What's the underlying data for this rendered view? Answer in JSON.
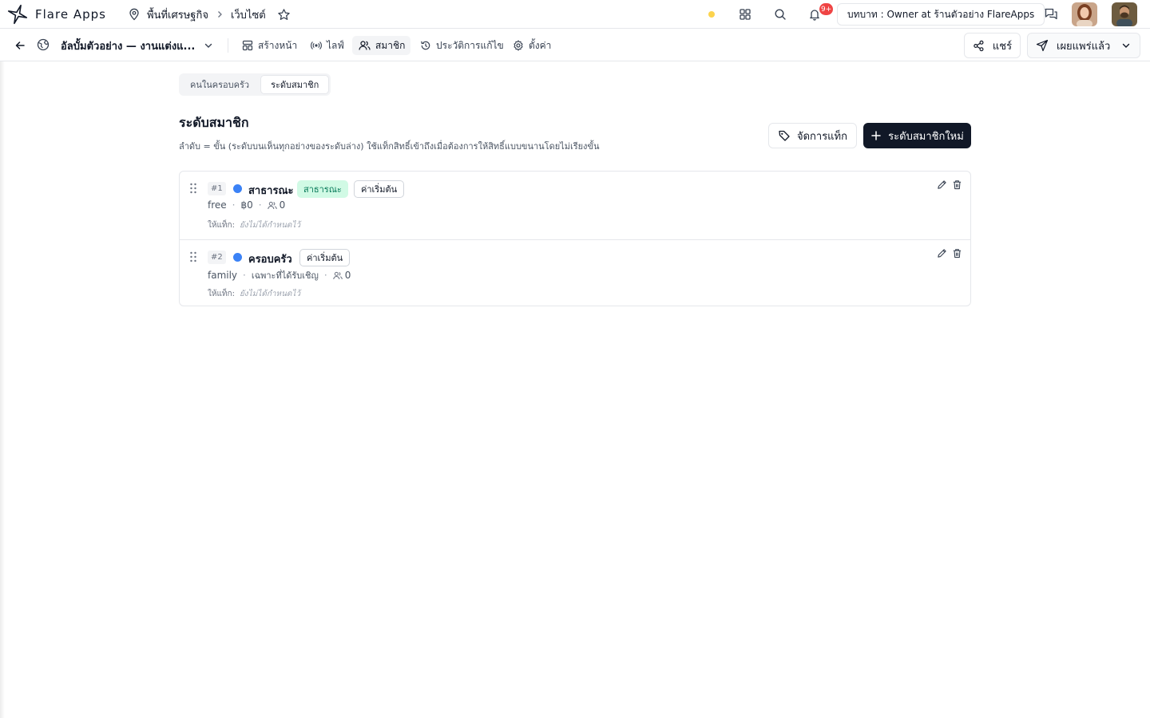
{
  "app": {
    "name": "Flare Apps"
  },
  "breadcrumb": {
    "workspace": "พื้นที่เศรษฐกิจ",
    "section": "เว็บไซต์"
  },
  "header": {
    "notification_count": "9+",
    "role": "บทบาท : Owner at ร้านตัวอย่าง FlareApps"
  },
  "project": {
    "title": "อัลบั้มตัวอย่าง — งานแต่งแ...",
    "tabs": [
      {
        "label": "สร้างหน้า",
        "icon": "layout-icon"
      },
      {
        "label": "ไลฟ์",
        "icon": "live-icon"
      },
      {
        "label": "สมาชิก",
        "icon": "users-icon",
        "active": true
      },
      {
        "label": "ประวัติการแก้ไข",
        "icon": "history-icon"
      },
      {
        "label": "ตั้งค่า",
        "icon": "gear-icon"
      }
    ],
    "share_label": "แชร์",
    "publish_label": "เผยแพร่แล้ว"
  },
  "segments": [
    {
      "label": "คนในครอบครัว",
      "active": false
    },
    {
      "label": "ระดับสมาชิก",
      "active": true
    }
  ],
  "page": {
    "title": "ระดับสมาชิก",
    "description": "ลำดับ = ขั้น (ระดับบนเห็นทุกอย่างของระดับล่าง) ใช้แท็กสิทธิ์เข้าถึงเมื่อต้องการให้สิทธิ์แบบขนานโดยไม่เรียงขั้น",
    "manage_tags_label": "จัดการแท็ก",
    "new_tier_label": "ระดับสมาชิกใหม่"
  },
  "tiers": [
    {
      "rank": "#1",
      "name": "สาธารณะ",
      "public_badge": "สาธารณะ",
      "default_badge": "ค่าเริ่มต้น",
      "key": "free",
      "access": "฿0",
      "members": "0",
      "tags_label": "ให้แท็ก:",
      "tags_value": "ยังไม่ได้กำหนดไว้",
      "color": "#3b82f6"
    },
    {
      "rank": "#2",
      "name": "ครอบครัว",
      "public_badge": "",
      "default_badge": "ค่าเริ่มต้น",
      "key": "family",
      "access": "เฉพาะที่ได้รับเชิญ",
      "members": "0",
      "tags_label": "ให้แท็ก:",
      "tags_value": "ยังไม่ได้กำหนดไว้",
      "color": "#3b82f6"
    }
  ],
  "colors": {
    "accent": "#111827",
    "public_badge_bg": "#d1fae5",
    "public_badge_text": "#047857",
    "tier_dot": "#3b82f6",
    "notification": "#ef4444",
    "status_dot": "#fcd34d"
  }
}
